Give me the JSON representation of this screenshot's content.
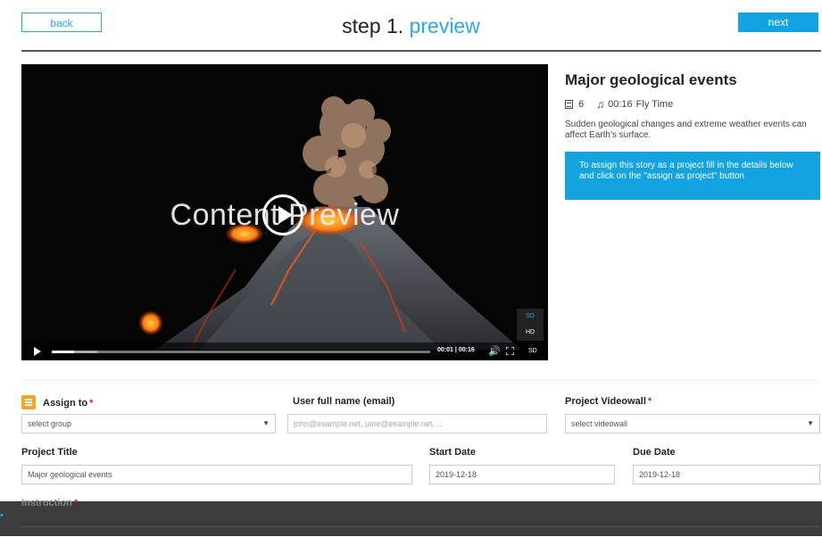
{
  "header": {
    "back_label": "back",
    "step_prefix": "step 1.",
    "step_name": "preview",
    "next_label": "next"
  },
  "video": {
    "watermark": "Content Preview",
    "quality_options": [
      "SD",
      "HD"
    ],
    "current_time": "00:01",
    "duration": "00:16",
    "quality_label": "SD",
    "progress_fraction": 0.06,
    "buffered_fraction": 0.12
  },
  "story": {
    "title": "Major geological events",
    "slides_count": "6",
    "duration": "00:16",
    "music": "Fly Time",
    "description": "Sudden geological changes and extreme weather events can affect Earth's surface.",
    "assign_hint": "To assign this story as a project fill in the details below and click on the \"assign as project\" button"
  },
  "form": {
    "assign_to": {
      "label": "Assign to",
      "value": "select group"
    },
    "user_name": {
      "label": "User full name (email)",
      "placeholder": "john@example.net, jane@example.net, ..."
    },
    "videowall": {
      "label": "Project Videowall",
      "value": "select videowall"
    },
    "project_title": {
      "label": "Project Title",
      "value": "Major geological events"
    },
    "start_date": {
      "label": "Start Date",
      "value": "2019-12-18"
    },
    "due_date": {
      "label": "Due Date",
      "value": "2019-12-18"
    },
    "instruction": {
      "label": "Instruction"
    },
    "required_mark": "*"
  },
  "colors": {
    "accent": "#12a3e0",
    "required": "#e02020",
    "assign_icon": "#f5a623"
  }
}
